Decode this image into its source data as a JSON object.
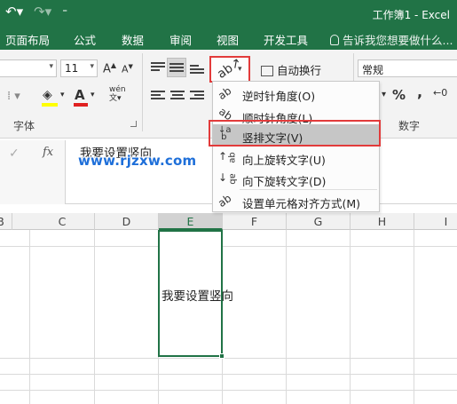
{
  "window": {
    "title": "工作簿1 - Excel"
  },
  "ribbon_tabs": [
    "页面布局",
    "公式",
    "数据",
    "审阅",
    "视图",
    "开发工具"
  ],
  "tell_me": "告诉我您想要做什么...",
  "font": {
    "size": "11",
    "group_label": "字体"
  },
  "alignment": {
    "wrap_text": "自动换行"
  },
  "number": {
    "format": "常规",
    "group_label": "数字",
    "percent": "%"
  },
  "orientation_menu": {
    "items": [
      {
        "icon": "angle-counterclockwise-icon",
        "label": "逆时针角度(O)"
      },
      {
        "icon": "angle-clockwise-icon",
        "label": "顺时针角度(L)"
      },
      {
        "icon": "vertical-text-icon",
        "label": "竖排文字(V)",
        "highlighted": true
      },
      {
        "icon": "rotate-text-up-icon",
        "label": "向上旋转文字(U)"
      },
      {
        "icon": "rotate-text-down-icon",
        "label": "向下旋转文字(D)"
      },
      {
        "icon": "format-cell-alignment-icon",
        "label": "设置单元格对齐方式(M)"
      }
    ]
  },
  "formula_bar": {
    "content": "我要设置竖向",
    "fx": "fx",
    "cancel": "✓"
  },
  "watermark": "www.rjzxw.com",
  "columns": [
    "B",
    "C",
    "D",
    "E",
    "F",
    "G",
    "H",
    "I"
  ],
  "selected_column": "E",
  "cell": {
    "value": "我要设置竖向"
  },
  "colors": {
    "excel_green": "#217346",
    "highlight_red": "#e23b3b",
    "watermark_blue": "#1e6fd9"
  }
}
